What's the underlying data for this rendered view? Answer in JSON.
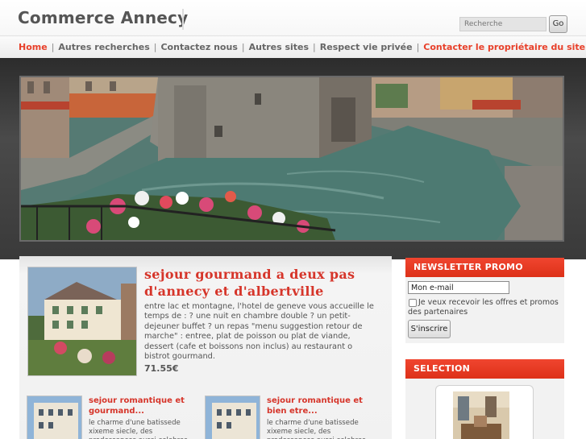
{
  "header": {
    "site_title": "Commerce Annecy",
    "search_placeholder": "Recherche",
    "go_label": "Go"
  },
  "nav": {
    "items": [
      "Home",
      "Autres recherches",
      "Contactez nous",
      "Autres sites",
      "Respect vie privée",
      "Contacter le propriétaire du site"
    ],
    "separator": "|"
  },
  "featured": {
    "title": "sejour gourmand a deux pas d'annecy et d'albertville",
    "description": "entre lac et montagne, l'hotel de geneve vous accueille le temps de : ? une nuit en chambre double ? un petit-dejeuner buffet ? un repas \"menu suggestion retour de marche\" : entree, plat de poisson ou plat de viande, dessert (cafe et boissons non inclus) au restaurant o bistrot gourmand.",
    "price": "71.55€"
  },
  "cards": [
    {
      "title": "sejour romantique et gourmand...",
      "description": "le charme d'une batissede xixeme siecle, des prodessances aussi celebres"
    },
    {
      "title": "sejour romantique et bien etre...",
      "description": "le charme d'une batissede xixeme siecle, des prodessances aussi celebres"
    }
  ],
  "newsletter": {
    "heading": "NEWSLETTER PROMO",
    "email_value": "Mon e-mail",
    "checkbox_label": "Je veux recevoir les offres et promos des partenaires",
    "subscribe_label": "S'inscrire"
  },
  "selection": {
    "heading": "SELECTION"
  },
  "colors": {
    "accent": "#e8402a",
    "sidebar_header": "#e3391f",
    "title_red": "#d6352a"
  }
}
